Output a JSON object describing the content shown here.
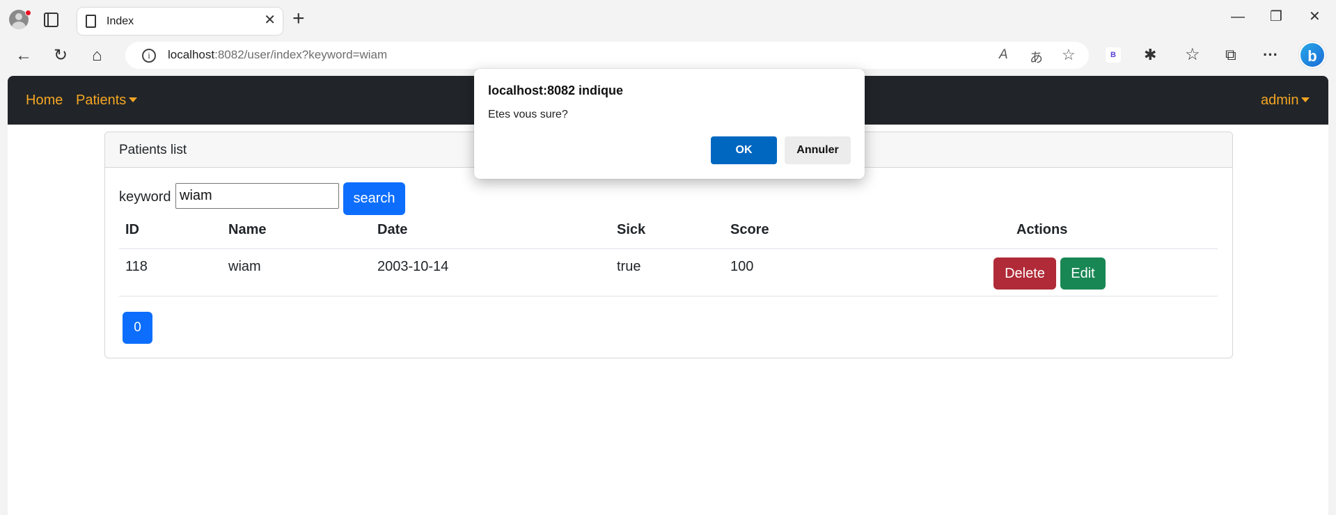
{
  "browser": {
    "tab": {
      "title": "Index",
      "close_glyph": "✕",
      "icon": "page-icon"
    },
    "new_tab_glyph": "+",
    "window_controls": {
      "minimize": "—",
      "restore": "❐",
      "close": "✕"
    },
    "nav": {
      "back": "←",
      "reload": "↻",
      "home": "⌂"
    },
    "url": {
      "host": "localhost",
      "rest": ":8082/user/index?keyword=wiam"
    },
    "omnibox_icons": {
      "read_aloud": "A",
      "translate": "あ",
      "favorite": "☆"
    },
    "extension_label": "B",
    "toolbar_icons": {
      "extensions": "✱",
      "favorites": "☆",
      "collections": "⧉",
      "more": "···"
    },
    "copilot_label": "b"
  },
  "app": {
    "navbar": {
      "home": "Home",
      "patients": "Patients",
      "user": "admin",
      "accent_color": "#f5a623"
    },
    "card": {
      "title": "Patients list",
      "search": {
        "label": "keyword",
        "value": "wiam",
        "button": "search"
      },
      "table": {
        "headers": [
          "ID",
          "Name",
          "Date",
          "Sick",
          "Score",
          "Actions"
        ],
        "rows": [
          {
            "id": "118",
            "name": "wiam",
            "date": "2003-10-14",
            "sick": "true",
            "score": "100",
            "delete": "Delete",
            "edit": "Edit"
          }
        ]
      },
      "pagination": [
        "0"
      ]
    }
  },
  "dialog": {
    "title": "localhost:8082 indique",
    "message": "Etes vous sure?",
    "ok": "OK",
    "cancel": "Annuler"
  }
}
